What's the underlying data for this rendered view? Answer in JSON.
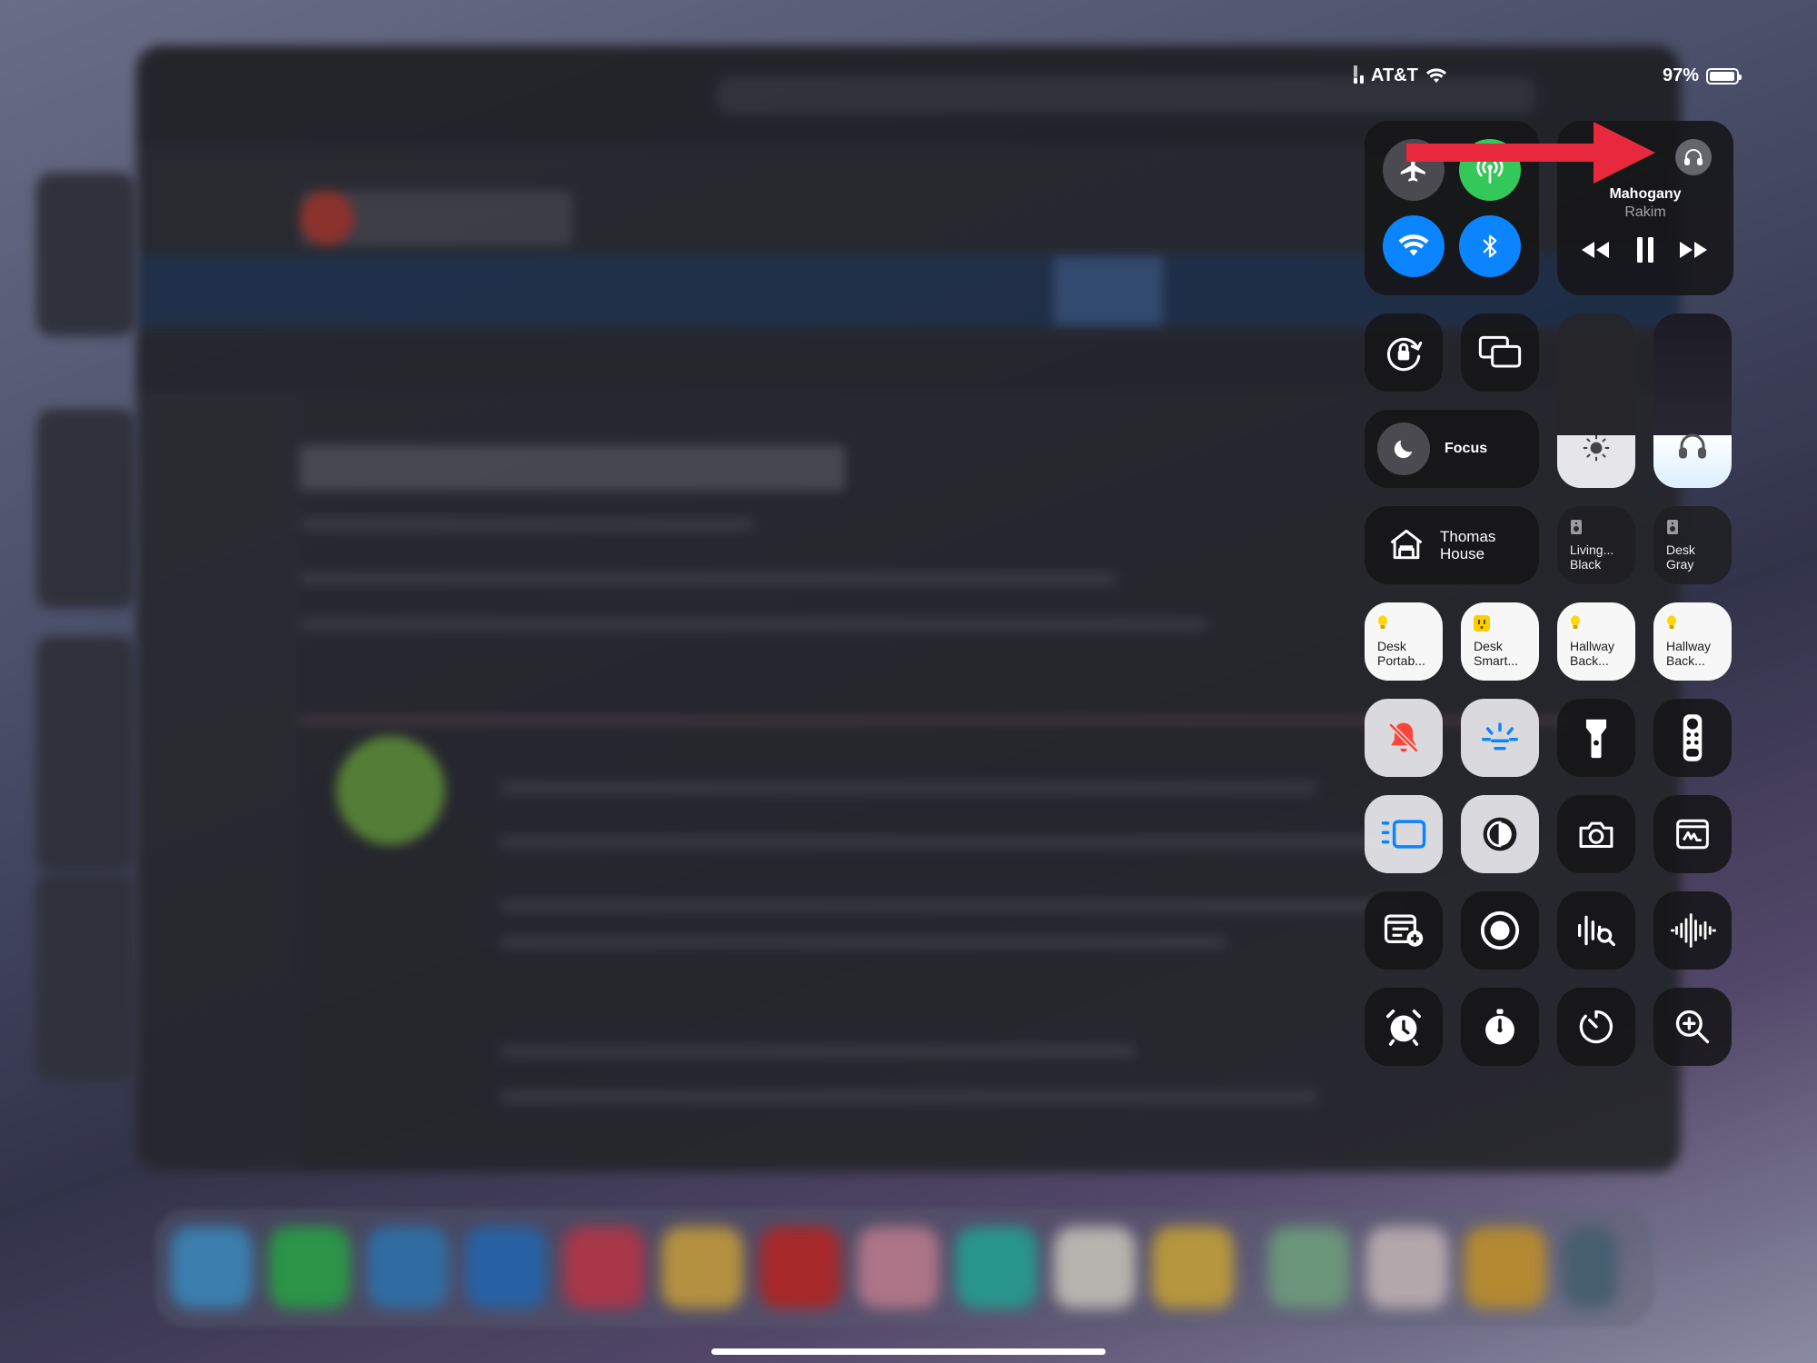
{
  "status_bar": {
    "carrier": "AT&T",
    "battery": "97%",
    "battery_level": 0.97,
    "signal_bars_active": 2,
    "signal_bars_total": 4,
    "icons": [
      "cellular-signal-icon",
      "wifi-icon",
      "battery-icon"
    ]
  },
  "connectivity": {
    "airplane_mode": {
      "icon": "airplane-icon",
      "active": false
    },
    "cellular_data": {
      "icon": "antenna-icon",
      "active": true
    },
    "wifi": {
      "icon": "wifi-icon",
      "active": true
    },
    "bluetooth": {
      "icon": "bluetooth-icon",
      "active": true
    }
  },
  "now_playing": {
    "title": "Mahogany",
    "artist": "Rakim",
    "output_icon": "headphones-icon",
    "controls": [
      "rewind-icon",
      "pause-icon",
      "fast-forward-icon"
    ]
  },
  "controls": {
    "orientation_lock_icon": "rotation-lock-icon",
    "screen_mirroring_icon": "screen-mirroring-icon",
    "focus": {
      "label": "Focus",
      "icon": "moon-icon"
    },
    "brightness": {
      "icon": "sun-icon",
      "level": 0.3
    },
    "volume": {
      "icon": "headphones-icon",
      "level": 0.3
    }
  },
  "home": {
    "label": "Thomas House",
    "icon": "house-icon",
    "speakers": [
      {
        "label": "Living...\nBlack",
        "icon": "speaker-icon"
      },
      {
        "label": "Desk\nGray",
        "icon": "speaker-icon"
      }
    ],
    "accessories": [
      {
        "label": "Desk\nPortab...",
        "icon": "lightbulb-icon"
      },
      {
        "label": "Desk\nSmart...",
        "icon": "outlet-icon"
      },
      {
        "label": "Hallway\nBack...",
        "icon": "lightbulb-icon"
      },
      {
        "label": "Hallway\nBack...",
        "icon": "lightbulb-icon"
      }
    ]
  },
  "grid_icons": [
    "silent-mode-icon",
    "true-tone-icon",
    "flashlight-icon",
    "apple-tv-remote-icon",
    "stage-manager-icon",
    "dark-mode-icon",
    "camera-icon",
    "quick-note-icon",
    "add-note-icon",
    "screen-recording-icon",
    "sound-recognition-icon",
    "voice-memos-icon",
    "alarm-icon",
    "stopwatch-icon",
    "timer-icon",
    "magnifier-icon"
  ],
  "colors": {
    "accent_blue": "#0a84ff",
    "accent_green": "#34c759",
    "arrow_red": "#e8283c",
    "bulb_yellow": "#ffd60a",
    "silent_red": "#ff453a"
  }
}
